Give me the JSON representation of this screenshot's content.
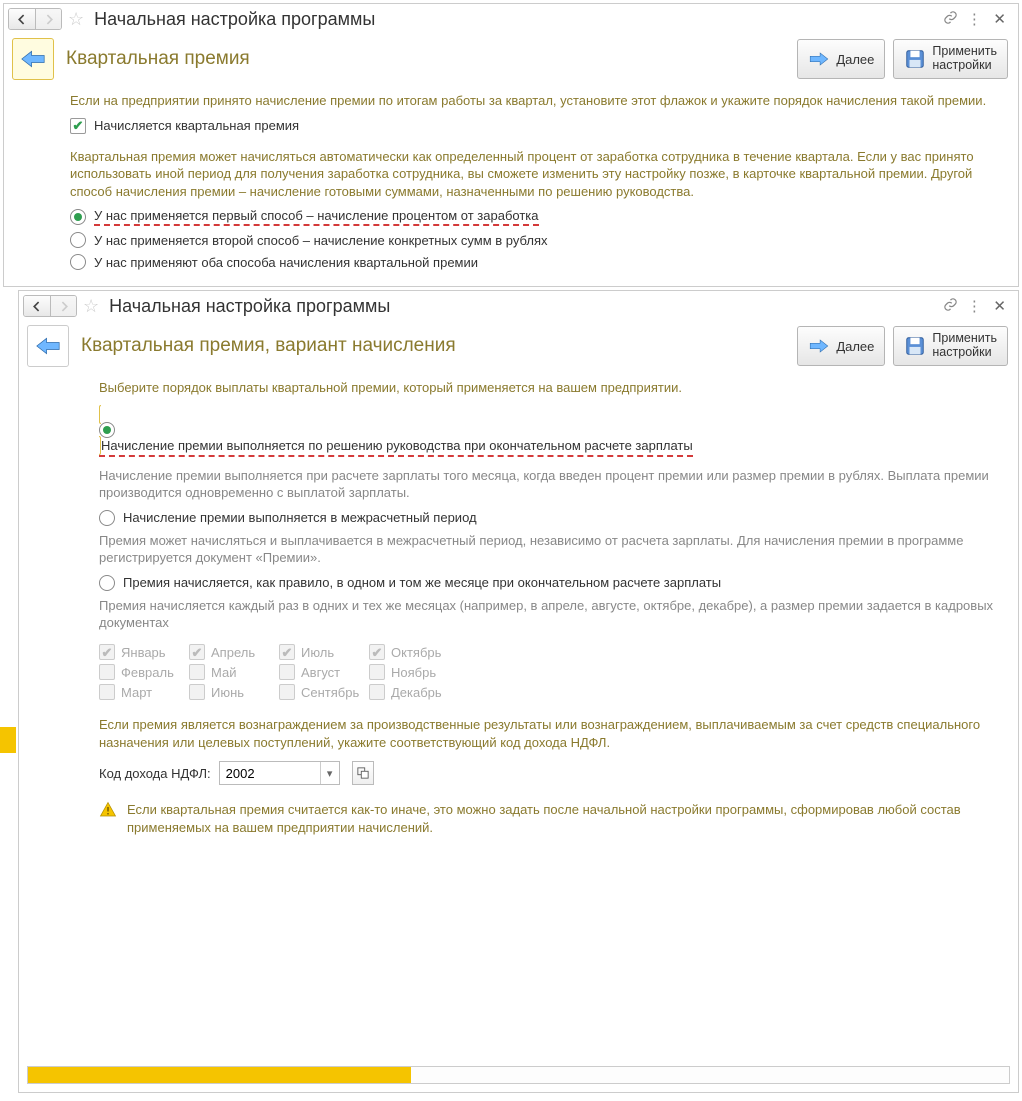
{
  "window1": {
    "title": "Начальная настройка программы",
    "sub_title": "Квартальная премия",
    "next": "Далее",
    "apply1": "Применить",
    "apply2": "настройки",
    "intro": "Если на предприятии принято начисление премии по итогам работы за квартал, установите этот флажок и укажите порядок начисления такой премии.",
    "check_label": "Начисляется квартальная премия",
    "desc2": "Квартальная премия может начисляться автоматически как определенный процент от заработка сотрудника в течение квартала. Если у вас принято использовать иной период для получения заработка сотрудника, вы сможете изменить эту настройку позже, в карточке квартальной премии. Другой способ начисления премии – начисление готовыми суммами, назначенными по решению руководства.",
    "opt1": "У нас применяется первый способ – начисление процентом от заработка",
    "opt2": "У нас применяется второй способ – начисление конкретных сумм в рублях",
    "opt3": "У нас применяют оба способа начисления квартальной премии"
  },
  "window2": {
    "title": "Начальная настройка программы",
    "sub_title": "Квартальная премия,  вариант начисления",
    "next": "Далее",
    "apply1": "Применить",
    "apply2": "настройки",
    "intro": "Выберите порядок выплаты квартальной премии, который применяется на вашем предприятии.",
    "opt1": "Начисление премии выполняется по решению руководства при окончательном расчете зарплаты",
    "desc1": "Начисление премии выполняется при расчете зарплаты того месяца, когда введен процент премии или размер премии в рублях. Выплата премии производится одновременно с выплатой зарплаты.",
    "opt2": "Начисление премии выполняется в межрасчетный период",
    "desc2": "Премия может начисляться и выплачивается в межрасчетный период, независимо от расчета зарплаты. Для начисления премии в программе регистрируется документ «Премии».",
    "opt3": "Премия начисляется, как правило, в одном и том же месяце при окончательном расчете зарплаты",
    "desc3": "Премия начисляется каждый раз в одних и тех же месяцах (например, в апреле, августе, октябре, декабре), а размер премии задается в кадровых документах",
    "months": {
      "jan": "Январь",
      "feb": "Февраль",
      "mar": "Март",
      "apr": "Апрель",
      "may": "Май",
      "jun": "Июнь",
      "jul": "Июль",
      "aug": "Август",
      "sep": "Сентябрь",
      "oct": "Октябрь",
      "nov": "Ноябрь",
      "dec": "Декабрь"
    },
    "ndfl_para": "Если премия является вознаграждением за производственные результаты или вознаграждением, выплачиваемым за счет средств специального назначения или целевых поступлений, укажите соответствующий код дохода НДФЛ.",
    "ndfl_label": "Код дохода НДФЛ:",
    "ndfl_value": "2002",
    "warn": "Если квартальная премия считается как-то иначе, это можно задать после начальной настройки программы, сформировав любой состав применяемых на вашем предприятии начислений.",
    "progress_pct": 39
  }
}
